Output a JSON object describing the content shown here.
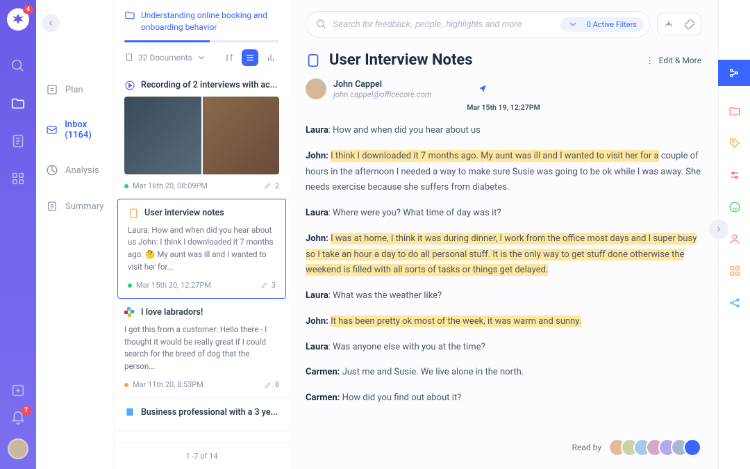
{
  "rail": {
    "logo_badge": "4",
    "bell_badge": "7"
  },
  "nav2": {
    "plan": "Plan",
    "inbox": "Inbox (1164)",
    "analysis": "Analysis",
    "summary": "Summary"
  },
  "folder": {
    "title": "Understanding online booking and onboarding behavior",
    "doc_count": "32 Documents"
  },
  "cards": [
    {
      "title": "Recording of 2 interviews with ac...",
      "date": "Mar 16th 20, 08:09PM",
      "highlights": "2",
      "dot": "green",
      "type": "video"
    },
    {
      "title": "User interview notes",
      "snippet": "Laura: How and when did you hear about us John:  I think I downloaded it 7 months ago. 🤔 My aunt was ill and I wanted to visit her for...",
      "date": "Mar 15th 20, 12:27PM",
      "highlights": "3",
      "dot": "green",
      "type": "note",
      "selected": true
    },
    {
      "title": "I love labradors!",
      "snippet": "I got this from a customer: Hello there - I thought it would be really great if I could search for the breed of dog that the person...",
      "date": "Mar 11th 20, 8:53PM",
      "highlights": "8",
      "dot": "orange",
      "type": "slack"
    },
    {
      "title": "Business professional with a 3 ye...",
      "type": "persona"
    }
  ],
  "pager": "1 -7 of 14",
  "search": {
    "placeholder": "Search for feedback, people, highlights and more",
    "filters": "0 Active Filters"
  },
  "doc": {
    "title": "User Interview Notes",
    "edit": "Edit & More",
    "author_name": "John Cappel",
    "author_email": "john.cappel@officecore.com",
    "timestamp": "Mar 15th 19, 12:27PM",
    "readby_label": "Read by"
  },
  "transcript": [
    {
      "speaker": "Laura",
      "text": ": How and when did you hear about us"
    },
    {
      "speaker": "John:",
      "hl": "I think I downloaded it 7 months ago. My aunt was ill and I wanted to visit her for a",
      "tail": "couple of hours in the afternoon I needed a way to make sure Susie was going to be ok while I was away. She needs exercise because she suffers from diabetes."
    },
    {
      "speaker": "Laura",
      "text": ": Where were you? What time of day was it?"
    },
    {
      "speaker": "John:",
      "hl": "I was at home, I think it was during dinner, I work from the office most days and I super busy so I take an hour a day to do all personal stuff. It is the only way to get stuff done otherwise the weekend is filled with all sorts of tasks or things get delayed."
    },
    {
      "speaker": "Laura",
      "text": ": What was the weather like?"
    },
    {
      "speaker": "John:",
      "hl": "It has been pretty ok most of the week, it was warm and sunny."
    },
    {
      "speaker": "Laura",
      "text": ": Was anyone else with you at the time?"
    },
    {
      "speaker": "Carmen:",
      "text": " Just me and Susie. We live alone in the north."
    },
    {
      "speaker": "Carmen:",
      "text": " How did you find out about it?"
    }
  ],
  "readby_colors": [
    "#e8b89a",
    "#c8d4a8",
    "#a8c8e8",
    "#d4a8c8",
    "#b8a8e8",
    "#a8b8d4",
    "#3a66ff"
  ]
}
